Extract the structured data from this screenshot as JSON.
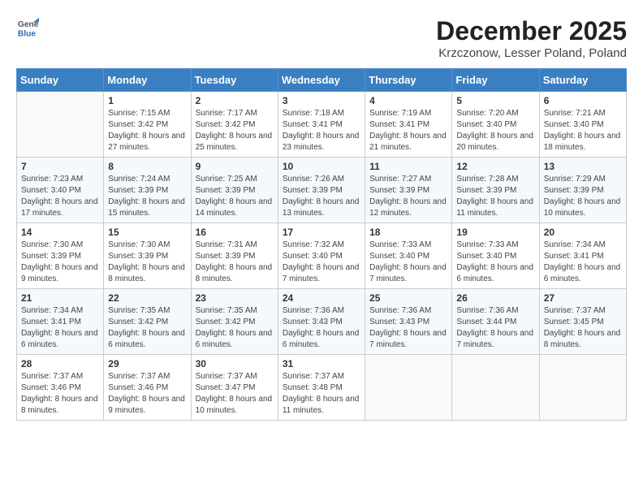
{
  "header": {
    "title": "December 2025",
    "subtitle": "Krzczonow, Lesser Poland, Poland",
    "logo_general": "General",
    "logo_blue": "Blue"
  },
  "days_of_week": [
    "Sunday",
    "Monday",
    "Tuesday",
    "Wednesday",
    "Thursday",
    "Friday",
    "Saturday"
  ],
  "weeks": [
    [
      {
        "day": null
      },
      {
        "day": 1,
        "sunrise": "7:15 AM",
        "sunset": "3:42 PM",
        "daylight": "8 hours and 27 minutes."
      },
      {
        "day": 2,
        "sunrise": "7:17 AM",
        "sunset": "3:42 PM",
        "daylight": "8 hours and 25 minutes."
      },
      {
        "day": 3,
        "sunrise": "7:18 AM",
        "sunset": "3:41 PM",
        "daylight": "8 hours and 23 minutes."
      },
      {
        "day": 4,
        "sunrise": "7:19 AM",
        "sunset": "3:41 PM",
        "daylight": "8 hours and 21 minutes."
      },
      {
        "day": 5,
        "sunrise": "7:20 AM",
        "sunset": "3:40 PM",
        "daylight": "8 hours and 20 minutes."
      },
      {
        "day": 6,
        "sunrise": "7:21 AM",
        "sunset": "3:40 PM",
        "daylight": "8 hours and 18 minutes."
      }
    ],
    [
      {
        "day": 7,
        "sunrise": "7:23 AM",
        "sunset": "3:40 PM",
        "daylight": "8 hours and 17 minutes."
      },
      {
        "day": 8,
        "sunrise": "7:24 AM",
        "sunset": "3:39 PM",
        "daylight": "8 hours and 15 minutes."
      },
      {
        "day": 9,
        "sunrise": "7:25 AM",
        "sunset": "3:39 PM",
        "daylight": "8 hours and 14 minutes."
      },
      {
        "day": 10,
        "sunrise": "7:26 AM",
        "sunset": "3:39 PM",
        "daylight": "8 hours and 13 minutes."
      },
      {
        "day": 11,
        "sunrise": "7:27 AM",
        "sunset": "3:39 PM",
        "daylight": "8 hours and 12 minutes."
      },
      {
        "day": 12,
        "sunrise": "7:28 AM",
        "sunset": "3:39 PM",
        "daylight": "8 hours and 11 minutes."
      },
      {
        "day": 13,
        "sunrise": "7:29 AM",
        "sunset": "3:39 PM",
        "daylight": "8 hours and 10 minutes."
      }
    ],
    [
      {
        "day": 14,
        "sunrise": "7:30 AM",
        "sunset": "3:39 PM",
        "daylight": "8 hours and 9 minutes."
      },
      {
        "day": 15,
        "sunrise": "7:30 AM",
        "sunset": "3:39 PM",
        "daylight": "8 hours and 8 minutes."
      },
      {
        "day": 16,
        "sunrise": "7:31 AM",
        "sunset": "3:39 PM",
        "daylight": "8 hours and 8 minutes."
      },
      {
        "day": 17,
        "sunrise": "7:32 AM",
        "sunset": "3:40 PM",
        "daylight": "8 hours and 7 minutes."
      },
      {
        "day": 18,
        "sunrise": "7:33 AM",
        "sunset": "3:40 PM",
        "daylight": "8 hours and 7 minutes."
      },
      {
        "day": 19,
        "sunrise": "7:33 AM",
        "sunset": "3:40 PM",
        "daylight": "8 hours and 6 minutes."
      },
      {
        "day": 20,
        "sunrise": "7:34 AM",
        "sunset": "3:41 PM",
        "daylight": "8 hours and 6 minutes."
      }
    ],
    [
      {
        "day": 21,
        "sunrise": "7:34 AM",
        "sunset": "3:41 PM",
        "daylight": "8 hours and 6 minutes."
      },
      {
        "day": 22,
        "sunrise": "7:35 AM",
        "sunset": "3:42 PM",
        "daylight": "8 hours and 6 minutes."
      },
      {
        "day": 23,
        "sunrise": "7:35 AM",
        "sunset": "3:42 PM",
        "daylight": "8 hours and 6 minutes."
      },
      {
        "day": 24,
        "sunrise": "7:36 AM",
        "sunset": "3:43 PM",
        "daylight": "8 hours and 6 minutes."
      },
      {
        "day": 25,
        "sunrise": "7:36 AM",
        "sunset": "3:43 PM",
        "daylight": "8 hours and 7 minutes."
      },
      {
        "day": 26,
        "sunrise": "7:36 AM",
        "sunset": "3:44 PM",
        "daylight": "8 hours and 7 minutes."
      },
      {
        "day": 27,
        "sunrise": "7:37 AM",
        "sunset": "3:45 PM",
        "daylight": "8 hours and 8 minutes."
      }
    ],
    [
      {
        "day": 28,
        "sunrise": "7:37 AM",
        "sunset": "3:46 PM",
        "daylight": "8 hours and 8 minutes."
      },
      {
        "day": 29,
        "sunrise": "7:37 AM",
        "sunset": "3:46 PM",
        "daylight": "8 hours and 9 minutes."
      },
      {
        "day": 30,
        "sunrise": "7:37 AM",
        "sunset": "3:47 PM",
        "daylight": "8 hours and 10 minutes."
      },
      {
        "day": 31,
        "sunrise": "7:37 AM",
        "sunset": "3:48 PM",
        "daylight": "8 hours and 11 minutes."
      },
      {
        "day": null
      },
      {
        "day": null
      },
      {
        "day": null
      }
    ]
  ]
}
